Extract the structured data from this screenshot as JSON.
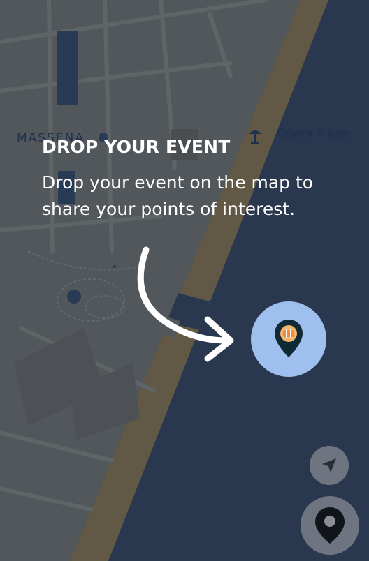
{
  "map": {
    "district_label": "MASSENA",
    "beach_label": "Opera Plage",
    "icons": [
      "beach-umbrella-icon"
    ]
  },
  "onboarding": {
    "title": "DROP YOUR EVENT",
    "description": "Drop your event on the map to share your points of interest."
  },
  "colors": {
    "sea": "#2f3f5a",
    "land": "#5e6468",
    "beach": "#6f6650",
    "drop_target": "#9fc0ef",
    "pin": "#0f2a35",
    "fab_background": "#b8b8b8"
  },
  "controls": [
    {
      "name": "locate-me-button",
      "icon": "navigation-arrow-icon"
    },
    {
      "name": "drop-event-button",
      "icon": "map-pin-icon"
    }
  ]
}
